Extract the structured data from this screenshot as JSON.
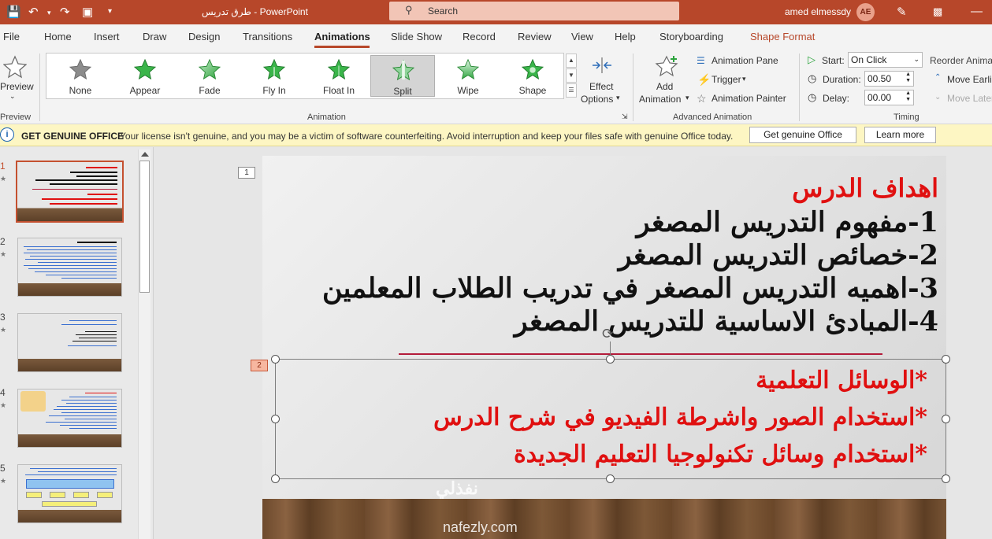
{
  "titlebar": {
    "doc_name": "طرق تدريس",
    "sep": "-",
    "app": "PowerPoint",
    "search_placeholder": "Search",
    "user": "amed elmessdy",
    "avatar": "AE"
  },
  "menu": [
    "File",
    "Home",
    "Insert",
    "Draw",
    "Design",
    "Transitions",
    "Animations",
    "Slide Show",
    "Record",
    "Review",
    "View",
    "Help",
    "Storyboarding",
    "Shape Format"
  ],
  "ribbon": {
    "preview_label": "Preview",
    "preview_group": "Preview",
    "animations": [
      "None",
      "Appear",
      "Fade",
      "Fly In",
      "Float In",
      "Split",
      "Wipe",
      "Shape"
    ],
    "selected_animation": "Split",
    "effect_options": [
      "Effect",
      "Options"
    ],
    "animation_group": "Animation",
    "add_animation": [
      "Add",
      "Animation"
    ],
    "animation_pane": "Animation Pane",
    "trigger": "Trigger",
    "animation_painter": "Animation Painter",
    "advanced_group": "Advanced Animation",
    "start_label": "Start:",
    "start_value": "On Click",
    "duration_label": "Duration:",
    "duration_value": "00.50",
    "delay_label": "Delay:",
    "delay_value": "00.00",
    "timing_group": "Timing",
    "reorder_label": "Reorder Animation",
    "move_earlier": "Move Earlier",
    "move_later": "Move Later"
  },
  "infobar": {
    "title": "GET GENUINE OFFICE",
    "message": "Your license isn't genuine, and you may be a victim of software counterfeiting. Avoid interruption and keep your files safe with genuine Office today.",
    "btn_genuine": "Get genuine Office",
    "btn_learn": "Learn more"
  },
  "thumbnails": [
    "1",
    "2",
    "3",
    "4",
    "5"
  ],
  "slide": {
    "tag1": "1",
    "tag2": "2",
    "title": "اهداف الدرس",
    "points": [
      "1-مفهوم التدريس المصغر",
      "2-خصائص التدريس المصغر",
      "3-اهميه التدريس المصغر في تدريب الطلاب المعلمين",
      "4-المبادئ الاساسية للتدريس المصغر"
    ],
    "tools": [
      "*الوسائل التعلمية",
      "*استخدام الصور واشرطة الفيديو في شرح الدرس",
      "*استخدام وسائل تكنولوجيا التعليم الجديدة"
    ]
  },
  "watermark": {
    "logo": "نفذلي",
    "url": "nafezly.com"
  },
  "colors": {
    "accent": "#b7472a",
    "slide_red": "#e01010"
  }
}
